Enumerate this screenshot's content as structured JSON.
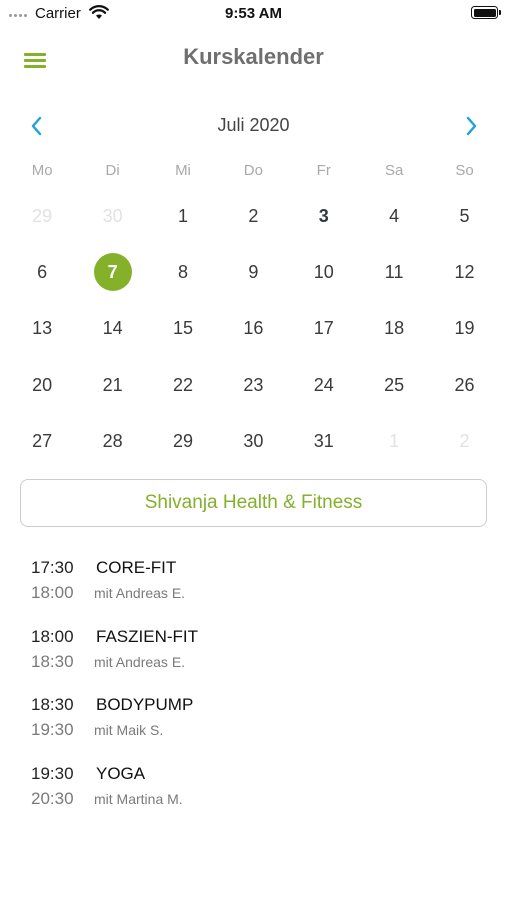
{
  "status": {
    "carrier": "Carrier",
    "time": "9:53 AM"
  },
  "nav": {
    "title": "Kurskalender",
    "menu_icon": "hamburger-menu-icon"
  },
  "calendar": {
    "month_label": "Juli 2020",
    "accent_color": "#84b02a",
    "weekdays": [
      "Mo",
      "Di",
      "Mi",
      "Do",
      "Fr",
      "Sa",
      "So"
    ],
    "days": [
      {
        "label": "29",
        "state": "other"
      },
      {
        "label": "30",
        "state": "other"
      },
      {
        "label": "1",
        "state": "normal"
      },
      {
        "label": "2",
        "state": "normal"
      },
      {
        "label": "3",
        "state": "today"
      },
      {
        "label": "4",
        "state": "normal"
      },
      {
        "label": "5",
        "state": "normal"
      },
      {
        "label": "6",
        "state": "normal"
      },
      {
        "label": "7",
        "state": "selected"
      },
      {
        "label": "8",
        "state": "normal"
      },
      {
        "label": "9",
        "state": "normal"
      },
      {
        "label": "10",
        "state": "normal"
      },
      {
        "label": "11",
        "state": "normal"
      },
      {
        "label": "12",
        "state": "normal"
      },
      {
        "label": "13",
        "state": "normal"
      },
      {
        "label": "14",
        "state": "normal"
      },
      {
        "label": "15",
        "state": "normal"
      },
      {
        "label": "16",
        "state": "normal"
      },
      {
        "label": "17",
        "state": "normal"
      },
      {
        "label": "18",
        "state": "normal"
      },
      {
        "label": "19",
        "state": "normal"
      },
      {
        "label": "20",
        "state": "normal"
      },
      {
        "label": "21",
        "state": "normal"
      },
      {
        "label": "22",
        "state": "normal"
      },
      {
        "label": "23",
        "state": "normal"
      },
      {
        "label": "24",
        "state": "normal"
      },
      {
        "label": "25",
        "state": "normal"
      },
      {
        "label": "26",
        "state": "normal"
      },
      {
        "label": "27",
        "state": "normal"
      },
      {
        "label": "28",
        "state": "normal"
      },
      {
        "label": "29",
        "state": "normal"
      },
      {
        "label": "30",
        "state": "normal"
      },
      {
        "label": "31",
        "state": "normal"
      },
      {
        "label": "1",
        "state": "other"
      },
      {
        "label": "2",
        "state": "other"
      }
    ]
  },
  "studio": {
    "label": "Shivanja Health & Fitness"
  },
  "classes": [
    {
      "start": "17:30",
      "end": "18:00",
      "name": "CORE-FIT",
      "trainer": "mit Andreas E."
    },
    {
      "start": "18:00",
      "end": "18:30",
      "name": "FASZIEN-FIT",
      "trainer": "mit Andreas E."
    },
    {
      "start": "18:30",
      "end": "19:30",
      "name": "BODYPUMP",
      "trainer": "mit Maik S."
    },
    {
      "start": "19:30",
      "end": "20:30",
      "name": "YOGA",
      "trainer": "mit Martina M."
    }
  ]
}
